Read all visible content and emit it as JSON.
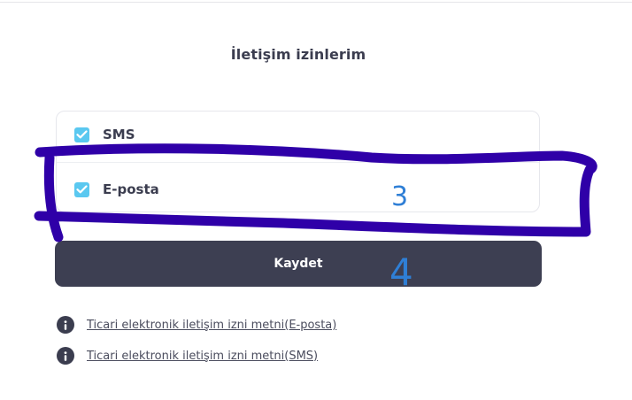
{
  "page": {
    "title": "İletişim izinlerim"
  },
  "permissions": {
    "items": [
      {
        "label": "SMS",
        "checked": true
      },
      {
        "label": "E-posta",
        "checked": true
      }
    ]
  },
  "actions": {
    "save_label": "Kaydet"
  },
  "links": [
    {
      "label": "Ticari elektronik iletişim izni metni(E-posta)",
      "icon": "info-icon"
    },
    {
      "label": "Ticari elektronik iletişim izni metni(SMS)",
      "icon": "info-icon"
    }
  ],
  "annotations": {
    "marker_color": "#2f00a8",
    "number_color": "#2f7fd6",
    "numbers": [
      "3",
      "4"
    ]
  },
  "colors": {
    "checkbox": "#5ac8f0",
    "button": "#3d3f52",
    "text": "#3b3d4f"
  }
}
